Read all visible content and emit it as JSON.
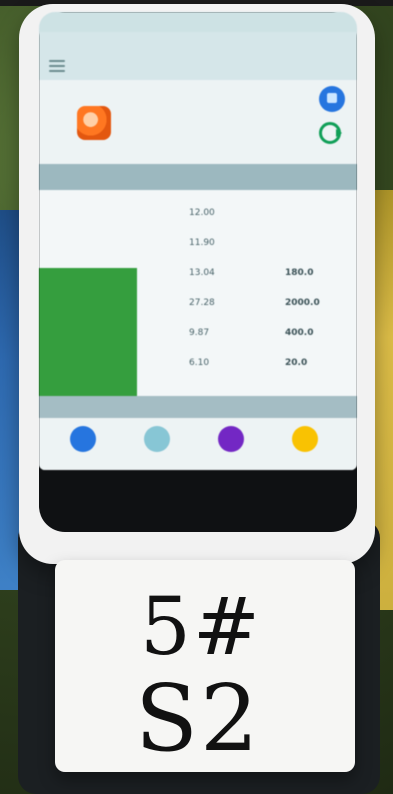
{
  "scene": {
    "handwritten_card": {
      "line1": "5#",
      "line2": "S2"
    },
    "colors": {
      "device_body": "#f2f2f2",
      "screen_bg": "#eef3f4",
      "header": "#d7e6e8",
      "table_header": "#9fb7bd",
      "green_block": "#2b8f33",
      "background_blue": "#2d6bb8",
      "background_yellow": "#e6c44a"
    }
  },
  "device": {
    "status_bar": {
      "center_text": "",
      "right_text": ""
    },
    "header": {
      "title": "",
      "right_text": ""
    },
    "table": {
      "rows": [
        {
          "c2": "12.00",
          "c3": ""
        },
        {
          "c2": "11.90",
          "c3": ""
        },
        {
          "c2": "13.04",
          "c3": "180.0"
        },
        {
          "c2": "27.28",
          "c3": "2000.0"
        },
        {
          "c2": "9.87",
          "c3": "400.0"
        },
        {
          "c2": "6.10",
          "c3": "20.0"
        }
      ]
    },
    "tabs": [],
    "apps": [
      {
        "icon": "person-icon",
        "label": ""
      },
      {
        "icon": "landscape-icon",
        "label": ""
      },
      {
        "icon": "document-icon",
        "label": ""
      },
      {
        "icon": "chart-icon",
        "label": ""
      }
    ]
  }
}
